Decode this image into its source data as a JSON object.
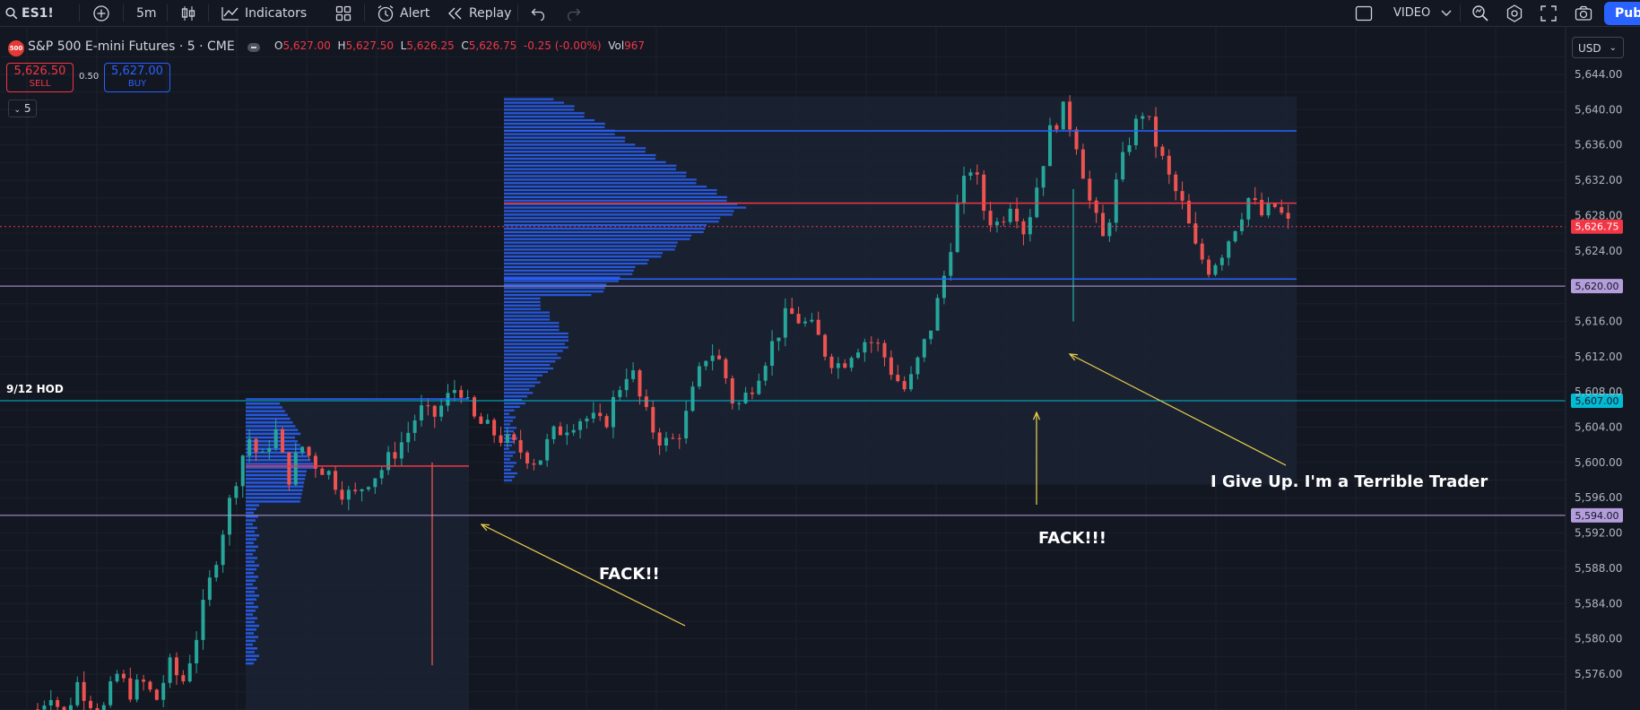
{
  "toolbar": {
    "symbol": "ES1!",
    "interval": "5m",
    "indicators_label": "Indicators",
    "alert_label": "Alert",
    "replay_label": "Replay",
    "video_label": "VIDEO",
    "publish_label": "Publish",
    "icons": [
      "search-icon",
      "plus-circle-icon",
      "candles-icon",
      "indicators-icon",
      "layouts-icon",
      "alert-clock-icon",
      "replay-icon",
      "undo-icon",
      "redo-icon",
      "square-icon",
      "chevron-down-icon",
      "zoom-icon",
      "settings-icon",
      "fullscreen-icon",
      "camera-icon"
    ]
  },
  "legend": {
    "badge": "500",
    "title": "S&P 500 E-mini Futures · 5 · CME",
    "open_key": "O",
    "open": "5,627.00",
    "high_key": "H",
    "high": "5,627.50",
    "low_key": "L",
    "low": "5,626.25",
    "close_key": "C",
    "close": "5,626.75",
    "change": "-0.25 (-0.00%)",
    "vol_key": "Vol",
    "vol": "967"
  },
  "trade": {
    "sell_price": "5,626.50",
    "sell_label": "SELL",
    "spread": "0.50",
    "buy_price": "5,627.00",
    "buy_label": "BUY"
  },
  "indicator_toggle": "5",
  "currency": "USD",
  "price_axis": {
    "ticks": [
      "5,644.00",
      "5,640.00",
      "5,636.00",
      "5,632.00",
      "5,628.00",
      "5,624.00",
      "5,616.00",
      "5,612.00",
      "5,608.00",
      "5,604.00",
      "5,600.00",
      "5,596.00",
      "5,592.00",
      "5,588.00",
      "5,584.00",
      "5,580.00",
      "5,576.00"
    ],
    "price_labels": [
      {
        "value": "5,626.75",
        "bg": "#f23645",
        "fg": "#ffffff"
      },
      {
        "value": "5,620.00",
        "bg": "#b39ddb",
        "fg": "#131722"
      },
      {
        "value": "5,607.00",
        "bg": "#00bcd4",
        "fg": "#131722"
      },
      {
        "value": "5,594.00",
        "bg": "#b39ddb",
        "fg": "#131722"
      }
    ]
  },
  "annotations": {
    "hod_label": "9/12 HOD",
    "note1": "FACK!!",
    "note2": "FACK!!!",
    "note3": "I Give Up. I'm a Terrible Trader"
  },
  "chart_data": {
    "type": "candlestick",
    "symbol": "ES1!",
    "interval": "5m",
    "ylim": [
      5572,
      5646
    ],
    "last_price": 5626.75,
    "horizontal_levels": [
      {
        "price": 5620.0,
        "color": "#b39ddb"
      },
      {
        "price": 5607.0,
        "color": "#00bcd4"
      },
      {
        "price": 5594.0,
        "color": "#b39ddb"
      }
    ],
    "close_path": [
      5572,
      5574,
      5571,
      5575,
      5573,
      5572,
      5576,
      5574,
      5575,
      5573,
      5577,
      5575,
      5580,
      5586,
      5592,
      5598,
      5603,
      5600,
      5604,
      5598,
      5602,
      5600,
      5599,
      5597,
      5596,
      5598,
      5599,
      5601,
      5603,
      5606,
      5605,
      5607,
      5609,
      5605,
      5604,
      5603,
      5602,
      5601,
      5600,
      5603,
      5604,
      5605,
      5605,
      5604,
      5608,
      5611,
      5606,
      5603,
      5602,
      5604,
      5609,
      5613,
      5611,
      5606,
      5608,
      5611,
      5614,
      5617,
      5616,
      5615,
      5612,
      5611,
      5613,
      5614,
      5613,
      5610,
      5608,
      5612,
      5616,
      5622,
      5630,
      5634,
      5628,
      5627,
      5630,
      5626,
      5632,
      5638,
      5640,
      5636,
      5629,
      5625,
      5632,
      5637,
      5640,
      5636,
      5632,
      5629,
      5624,
      5622,
      5624,
      5627,
      5630,
      5628,
      5629,
      5627
    ]
  }
}
